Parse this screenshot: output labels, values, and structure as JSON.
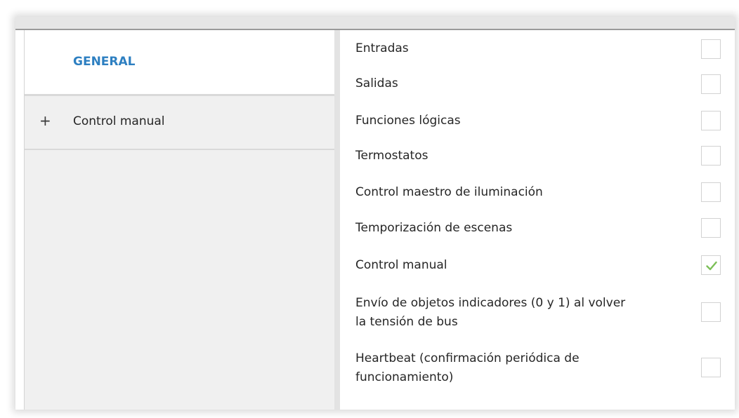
{
  "sidebar": {
    "general_label": "GENERAL",
    "expand_symbol": "+",
    "manual_label": "Control manual"
  },
  "options": [
    {
      "label": "Entradas",
      "checked": false
    },
    {
      "label": "Salidas",
      "checked": false
    },
    {
      "label": "Funciones lógicas",
      "checked": false
    },
    {
      "label": "Termostatos",
      "checked": false
    },
    {
      "label": "Control maestro de iluminación",
      "checked": false
    },
    {
      "label": "Temporización de escenas",
      "checked": false
    },
    {
      "label": "Control manual",
      "checked": true
    },
    {
      "label_line1": "Envío de objetos indicadores (0 y 1) al volver",
      "label_line2": "la tensión de bus",
      "checked": false
    },
    {
      "label_line1": "Heartbeat (confirmación periódica de",
      "label_line2": "funcionamiento)",
      "checked": false
    }
  ],
  "colors": {
    "accent": "#2d7fc1",
    "check": "#7cbf57"
  }
}
